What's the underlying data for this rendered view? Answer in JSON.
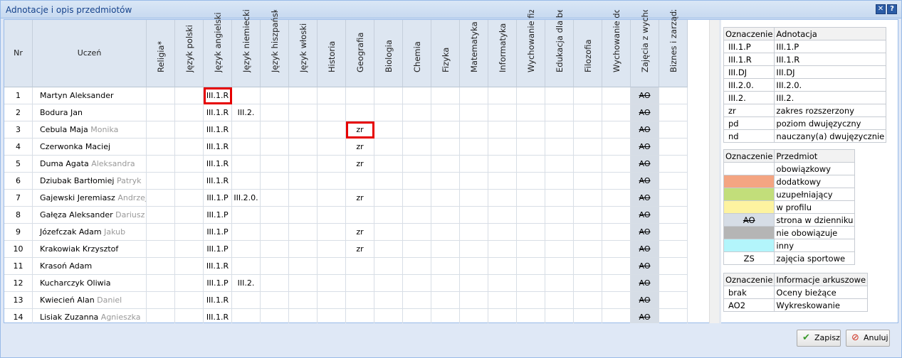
{
  "window": {
    "title": "Adnotacje i opis przedmiotów"
  },
  "columns": {
    "nr": "Nr",
    "student": "Uczeń",
    "subjects": [
      {
        "label": "Religia",
        "required": true
      },
      {
        "label": "Język polski"
      },
      {
        "label": "Język angielski"
      },
      {
        "label": "Język niemiecki"
      },
      {
        "label": "Język hiszpański"
      },
      {
        "label": "Język włoski"
      },
      {
        "label": "Historia"
      },
      {
        "label": "Geografia"
      },
      {
        "label": "Biologia"
      },
      {
        "label": "Chemia"
      },
      {
        "label": "Fizyka"
      },
      {
        "label": "Matematyka"
      },
      {
        "label": "Informatyka"
      },
      {
        "label": "Wychowanie fizyc"
      },
      {
        "label": "Edukacja dla bezp"
      },
      {
        "label": "Filozofia"
      },
      {
        "label": "Wychowanie do ż"
      },
      {
        "label": "Zajęcia z wychow"
      },
      {
        "label": "Biznes i zarządza"
      }
    ]
  },
  "rows": [
    {
      "nr": "1",
      "first": "Martyn Aleksander",
      "second": "",
      "angielski": "III.1.R",
      "niemiecki": "",
      "geografia": ""
    },
    {
      "nr": "2",
      "first": "Bodura Jan",
      "second": "",
      "angielski": "III.1.R",
      "niemiecki": "III.2.",
      "geografia": ""
    },
    {
      "nr": "3",
      "first": "Cebula Maja",
      "second": "Monika",
      "angielski": "III.1.R",
      "niemiecki": "",
      "geografia": "zr"
    },
    {
      "nr": "4",
      "first": "Czerwonka Maciej",
      "second": "",
      "angielski": "III.1.R",
      "niemiecki": "",
      "geografia": "zr"
    },
    {
      "nr": "5",
      "first": "Duma Agata",
      "second": "Aleksandra",
      "angielski": "III.1.R",
      "niemiecki": "",
      "geografia": "zr"
    },
    {
      "nr": "6",
      "first": "Dziubak Bartłomiej",
      "second": "Patryk",
      "angielski": "III.1.R",
      "niemiecki": "",
      "geografia": ""
    },
    {
      "nr": "7",
      "first": "Gajewski Jeremiasz",
      "second": "Andrzej",
      "angielski": "III.1.P",
      "niemiecki": "III.2.0.",
      "geografia": "zr"
    },
    {
      "nr": "8",
      "first": "Gałęza Aleksander",
      "second": "Dariusz",
      "angielski": "III.1.P",
      "niemiecki": "",
      "geografia": ""
    },
    {
      "nr": "9",
      "first": "Józefczak Adam",
      "second": "Jakub",
      "angielski": "III.1.P",
      "niemiecki": "",
      "geografia": "zr"
    },
    {
      "nr": "10",
      "first": "Krakowiak Krzysztof",
      "second": "",
      "angielski": "III.1.P",
      "niemiecki": "",
      "geografia": "zr"
    },
    {
      "nr": "11",
      "first": "Krasoń Adam",
      "second": "",
      "angielski": "III.1.R",
      "niemiecki": "",
      "geografia": ""
    },
    {
      "nr": "12",
      "first": "Kucharczyk Oliwia",
      "second": "",
      "angielski": "III.1.P",
      "niemiecki": "III.2.",
      "geografia": ""
    },
    {
      "nr": "13",
      "first": "Kwiecień Alan",
      "second": "Daniel",
      "angielski": "III.1.R",
      "niemiecki": "",
      "geografia": ""
    },
    {
      "nr": "14",
      "first": "Lisiak Zuzanna",
      "second": "Agnieszka",
      "angielski": "III.1.R",
      "niemiecki": "",
      "geografia": ""
    }
  ],
  "zajecia_mark": "AO",
  "legend_adnotacje": {
    "headers": [
      "Oznaczenie",
      "Adnotacja"
    ],
    "rows": [
      [
        "III.1.P",
        "III.1.P"
      ],
      [
        "III.1.R",
        "III.1.R"
      ],
      [
        "III.DJ",
        "III.DJ"
      ],
      [
        "III.2.0.",
        "III.2.0."
      ],
      [
        "III.2.",
        "III.2."
      ],
      [
        "zr",
        "zakres rozszerzony"
      ],
      [
        "pd",
        "poziom dwujęzyczny"
      ],
      [
        "nd",
        "nauczany(a) dwujęzycznie"
      ]
    ]
  },
  "legend_przedmiot": {
    "headers": [
      "Oznaczenie",
      "Przedmiot"
    ],
    "rows": [
      {
        "mark": "",
        "color": "#ffffff",
        "label": "obowiązkowy"
      },
      {
        "mark": "",
        "color": "#f4a582",
        "label": "dodatkowy"
      },
      {
        "mark": "",
        "color": "#c2de7a",
        "label": "uzupełniający"
      },
      {
        "mark": "",
        "color": "#fdf3a0",
        "label": "w profilu"
      },
      {
        "mark": "AO",
        "color": "#d6dde6",
        "label": "strona w dzienniku"
      },
      {
        "mark": "",
        "color": "#b5b5b5",
        "label": "nie obowiązuje"
      },
      {
        "mark": "",
        "color": "#b3f5fb",
        "label": "inny"
      },
      {
        "mark": "ZS",
        "color": "#ffffff",
        "label": "zajęcia sportowe"
      }
    ]
  },
  "legend_arkusz": {
    "headers": [
      "Oznaczenie",
      "Informacje arkuszowe"
    ],
    "rows": [
      [
        "brak",
        "Oceny bieżące"
      ],
      [
        "AO2",
        "Wykreskowanie"
      ]
    ]
  },
  "buttons": {
    "save": "Zapisz",
    "cancel": "Anuluj"
  }
}
